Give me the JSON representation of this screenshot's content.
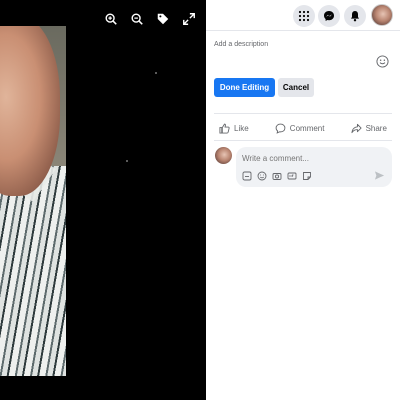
{
  "viewer": {
    "tools": [
      "zoom-in-icon",
      "zoom-out-icon",
      "tag-icon",
      "fullscreen-icon"
    ]
  },
  "topbar": {
    "icons": [
      "menu-grid-icon",
      "messenger-icon",
      "notifications-icon"
    ]
  },
  "description": {
    "placeholder": "Add a description"
  },
  "buttons": {
    "done_label": "Done Editing",
    "cancel_label": "Cancel"
  },
  "actions": {
    "like_label": "Like",
    "comment_label": "Comment",
    "share_label": "Share"
  },
  "comment": {
    "placeholder": "Write a comment..."
  },
  "colors": {
    "accent": "#1877f2",
    "secondary_button": "#e4e6eb",
    "muted_text": "#65676b",
    "viewer_bg": "#000000"
  }
}
